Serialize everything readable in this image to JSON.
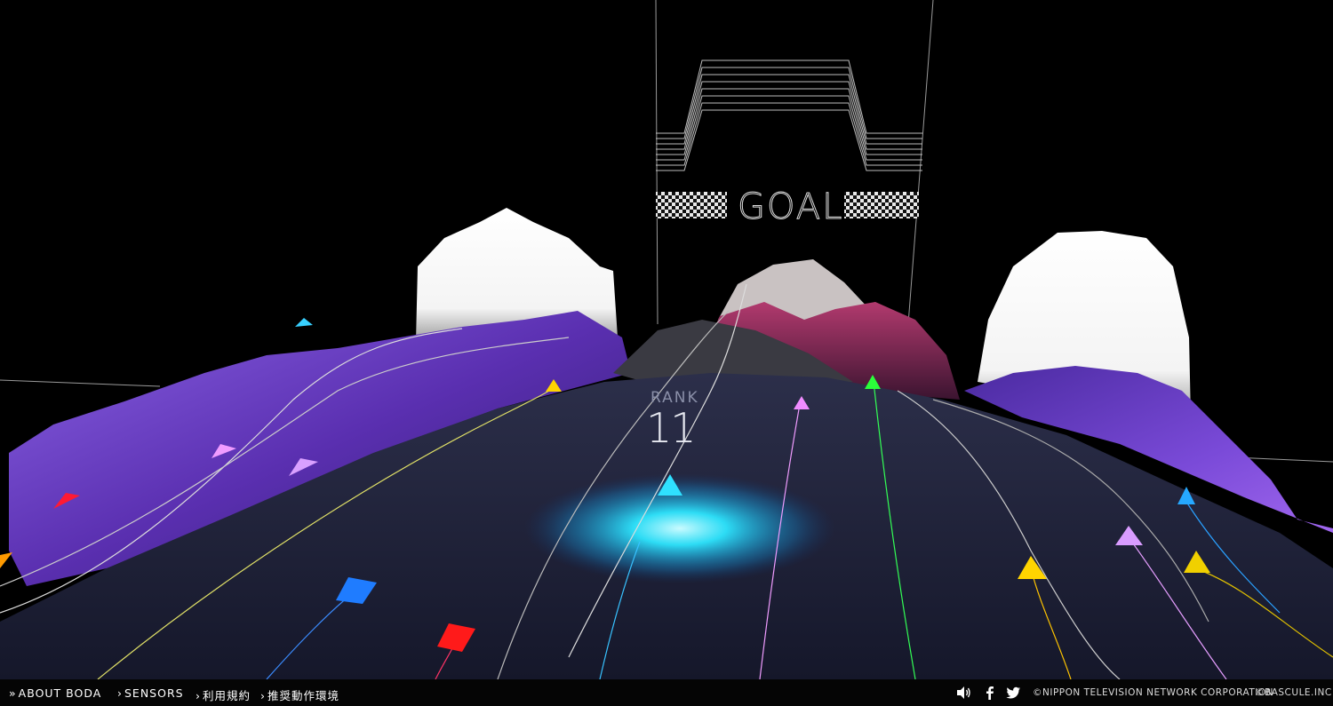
{
  "hud": {
    "goal": "GOAL",
    "rank_label": "RANK",
    "rank_value": "11"
  },
  "footer": {
    "nav": [
      {
        "chevron": "»",
        "label": "ABOUT BODA"
      },
      {
        "chevron": "›",
        "label": "SENSORS"
      },
      {
        "chevron": "›",
        "label": "利用規約"
      },
      {
        "chevron": "›",
        "label": "推奨動作環境"
      }
    ],
    "icons": [
      "sound-icon",
      "facebook-icon",
      "twitter-icon"
    ],
    "copyright_ntv": "©NIPPON TELEVISION NETWORK CORPORATION",
    "copyright_bascule": "©BASCULE.INC"
  },
  "colors": {
    "background": "#000000",
    "track": "#22253a",
    "mountain_purple": "#6a3fc4",
    "mountain_crimson": "#8a2150",
    "snow": "#ffffff",
    "glow": "#22e3ff"
  },
  "markers": [
    {
      "name": "marker-cyan-player",
      "color": "#2fe0ff"
    },
    {
      "name": "marker-red",
      "color": "#ff1a1a"
    },
    {
      "name": "marker-blue",
      "color": "#1f7cff"
    },
    {
      "name": "marker-yellow",
      "color": "#ffd400"
    },
    {
      "name": "marker-pink",
      "color": "#f08cff"
    },
    {
      "name": "marker-green",
      "color": "#2bff3a"
    },
    {
      "name": "marker-violet",
      "color": "#d99cff"
    }
  ]
}
